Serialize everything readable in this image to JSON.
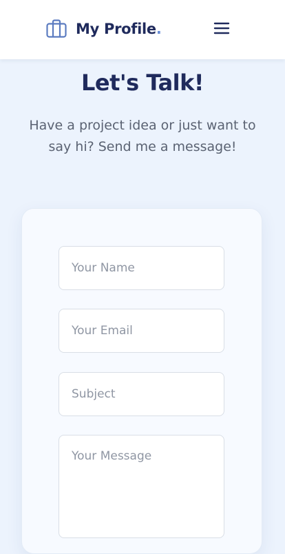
{
  "header": {
    "brand_name": "My Profile",
    "brand_dot": ".",
    "brand_icon": "briefcase-icon",
    "menu_icon": "hamburger-menu-icon"
  },
  "hero": {
    "title": "Let's Talk!",
    "subtitle": "Have a project idea or just want to say hi? Send me a message!"
  },
  "form": {
    "name_placeholder": "Your Name",
    "email_placeholder": "Your Email",
    "subject_placeholder": "Subject",
    "message_placeholder": "Your Message"
  },
  "colors": {
    "primary_text": "#1f2a5c",
    "accent": "#6b8fd6",
    "page_background": "#ecf3fd",
    "card_background": "#f7faff"
  }
}
